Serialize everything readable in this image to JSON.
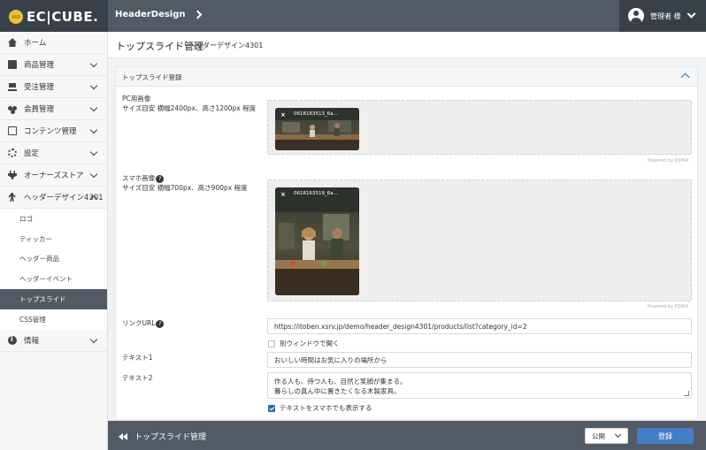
{
  "header": {
    "logo": "EC|CUBE.",
    "breadcrumb": "HeaderDesign",
    "user": "管理者 様"
  },
  "sidebar": {
    "items": [
      {
        "label": "ホーム",
        "icon": "home-icon"
      },
      {
        "label": "商品管理",
        "icon": "box-icon"
      },
      {
        "label": "受注管理",
        "icon": "cart-icon"
      },
      {
        "label": "会員管理",
        "icon": "users-icon"
      },
      {
        "label": "コンテンツ管理",
        "icon": "document-icon"
      },
      {
        "label": "設定",
        "icon": "gear-icon"
      },
      {
        "label": "オーナーズストア",
        "icon": "plug-icon"
      },
      {
        "label": "ヘッダーデザイン4301",
        "icon": "person-icon"
      }
    ],
    "subitems": [
      "ロゴ",
      "ティッカー",
      "ヘッダー商品",
      "ヘッダーイベント",
      "トップスライド",
      "CSS管理"
    ],
    "active_sub": "トップスライド",
    "info": {
      "label": "情報",
      "icon": "info-icon"
    }
  },
  "page": {
    "title": "トップスライド管理",
    "subtitle": "ヘッダーデザイン4301"
  },
  "form": {
    "card_title": "トップスライド登録",
    "pc_image_label": "PC用画像",
    "pc_image_hint": "サイズ目安 横幅2400px、高さ1200px 程度",
    "pc_image_file": "0618163513_6a...",
    "sp_image_label": "スマホ画像",
    "sp_image_hint": "サイズ目安 横幅700px、高さ900px 程度",
    "sp_image_file": "0618163519_6a...",
    "powered_by": "Powered by PQINA",
    "help_mark": "?",
    "link_label": "リンクURL",
    "link_value": "https://itoben.xsrv.jp/demo/header_design4301/products/list?category_id=2",
    "new_window_label": "別ウィンドウで開く",
    "text1_label": "テキスト1",
    "text1_value": "おいしい時間はお気に入りの場所から",
    "text2_label": "テキスト2",
    "text2_line1": "作る人も、待つ人も、自然と笑顔が集まる。",
    "text2_line2": "暮らしの真ん中に置きたくなる木製家具。",
    "show_on_mobile_label": "テキストをスマホでも表示する"
  },
  "footer": {
    "back_label": "トップスライド管理",
    "status_value": "公開",
    "submit_label": "登録"
  },
  "colors": {
    "header_bg": "#525a66",
    "header_dark": "#394049",
    "accent": "#437ec4",
    "active_sub_bg": "#525a66"
  }
}
